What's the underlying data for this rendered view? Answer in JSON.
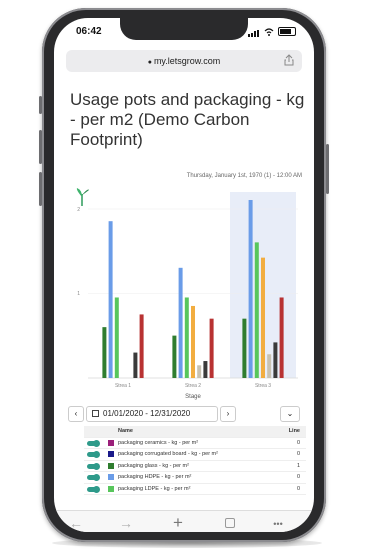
{
  "status_bar": {
    "time": "06:42"
  },
  "browser": {
    "url": "my.letsgrow.com"
  },
  "page": {
    "title": "Usage pots and packaging - kg - per m2 (Demo Carbon Footprint)",
    "timestamp": "Thursday, January 1st, 1970 (1) - 12:00 AM"
  },
  "chart_data": {
    "type": "bar",
    "xlabel": "Stage",
    "ylabel": "",
    "ylim": [
      0,
      2.1
    ],
    "yticks": [
      "1",
      "2"
    ],
    "categories": [
      "Strea 1",
      "Strea 2",
      "Strea 3"
    ],
    "highlighted_category": "Strea 3",
    "series": [
      {
        "color": "#2f7d2f",
        "values": [
          0.6,
          0.5,
          0.7
        ]
      },
      {
        "color": "#6a9ce8",
        "values": [
          1.85,
          1.3,
          2.1
        ]
      },
      {
        "color": "#58c65c",
        "values": [
          0.95,
          0.95,
          1.6
        ]
      },
      {
        "color": "#f2ad40",
        "values": [
          0.0,
          0.85,
          1.42
        ]
      },
      {
        "color": "#c8c2b2",
        "values": [
          0.0,
          0.15,
          0.28
        ]
      },
      {
        "color": "#3a3a3a",
        "values": [
          0.3,
          0.2,
          0.42
        ]
      },
      {
        "color": "#b83232",
        "values": [
          0.75,
          0.7,
          0.95
        ]
      }
    ]
  },
  "date_range": {
    "text": "01/01/2020 - 12/31/2020"
  },
  "legend": {
    "header": {
      "name": "Name",
      "line": "Line"
    },
    "items": [
      {
        "name": "packaging ceramics - kg - per m²",
        "color": "#9b1f7a",
        "line": "0"
      },
      {
        "name": "packaging corrugated board - kg - per m²",
        "color": "#1a1a8a",
        "line": "0"
      },
      {
        "name": "packaging glass - kg - per m²",
        "color": "#2f7d2f",
        "line": "1"
      },
      {
        "name": "packaging HDPE - kg - per m²",
        "color": "#6a9ce8",
        "line": "0"
      },
      {
        "name": "packaging LDPE - kg - per m²",
        "color": "#58c65c",
        "line": "0"
      }
    ]
  },
  "toolbar": {
    "back": "←",
    "forward": "→",
    "add": "+",
    "more": "•••"
  },
  "icons": {
    "lock": "lock-icon",
    "share": "share-icon",
    "calendar": "calendar-icon",
    "plant": "plant-logo-icon"
  }
}
